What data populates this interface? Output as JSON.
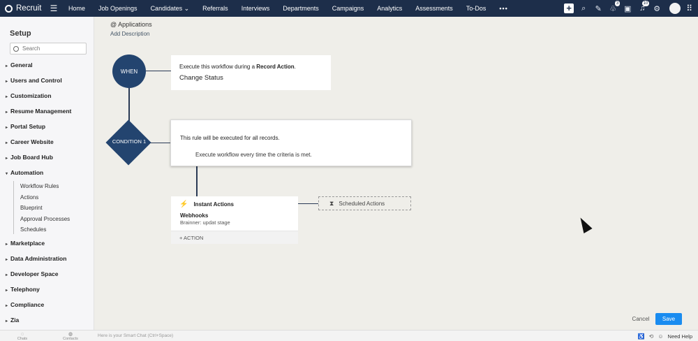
{
  "topnav": {
    "brand": "Recruit",
    "items": [
      "Home",
      "Job Openings",
      "Candidates",
      "Referrals",
      "Interviews",
      "Departments",
      "Campaigns",
      "Analytics",
      "Assessments",
      "To-Dos"
    ],
    "candidates_caret": "⌄",
    "more": "•••",
    "badges": {
      "referrals": "3",
      "notifications": "10"
    }
  },
  "sidebar": {
    "title": "Setup",
    "search_placeholder": "Search",
    "sections": [
      "General",
      "Users and Control",
      "Customization",
      "Resume Management",
      "Portal Setup",
      "Career Website",
      "Job Board Hub",
      "Automation",
      "Marketplace",
      "Data Administration",
      "Developer Space",
      "Telephony",
      "Compliance",
      "Zia"
    ],
    "automation_items": [
      "Workflow Rules",
      "Actions",
      "Blueprint",
      "Approval Processes",
      "Schedules"
    ]
  },
  "main": {
    "module": "@ Applications",
    "add_description": "Add Description",
    "when_label": "WHEN",
    "when_text_pre": "Execute this workflow during a ",
    "when_text_bold": "Record Action",
    "when_text_post": ".",
    "when_action": "Change Status",
    "condition_label": "CONDITION 1",
    "condition_text": "This rule will be executed for all records.",
    "condition_sub": "Execute workflow every time the criteria is met.",
    "instant_actions": "Instant Actions",
    "webhooks": "Webhooks",
    "webhook_detail": "Brainner: updat stage",
    "add_action": "+ ACTION",
    "scheduled_actions": "Scheduled Actions",
    "cancel": "Cancel",
    "save": "Save"
  },
  "bottombar": {
    "chats": "Chats",
    "contacts": "Contacts",
    "smart_chat": "Here is your Smart Chat (Ctrl+Space)",
    "need_help": "Need Help"
  },
  "colors": {
    "nav_bg": "#1d2e4a",
    "node_bg": "#23446f",
    "save_bg": "#1a8cf0",
    "canvas_bg": "#efeee9"
  }
}
